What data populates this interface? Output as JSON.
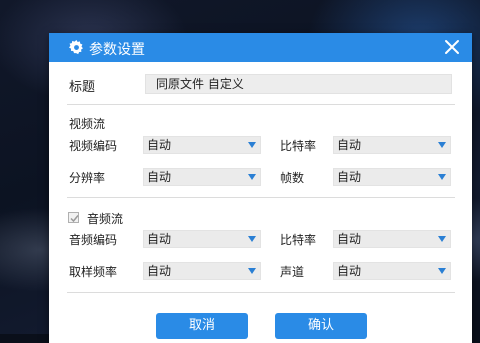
{
  "dialog": {
    "title": "参数设置",
    "name_label": "标题",
    "name_value": "同原文件 自定义"
  },
  "video": {
    "section_label": "视频流",
    "codec_label": "视频编码",
    "codec_value": "自动",
    "bitrate_label": "比特率",
    "bitrate_value": "自动",
    "resolution_label": "分辨率",
    "resolution_value": "自动",
    "framerate_label": "帧数",
    "framerate_value": "自动"
  },
  "audio": {
    "enabled": true,
    "section_label": "音频流",
    "codec_label": "音频编码",
    "codec_value": "自动",
    "bitrate_label": "比特率",
    "bitrate_value": "自动",
    "samplerate_label": "取样频率",
    "samplerate_value": "自动",
    "channel_label": "声道",
    "channel_value": "自动"
  },
  "buttons": {
    "cancel_label": "取消",
    "ok_label": "确认"
  },
  "colors": {
    "accent": "#2a8be6",
    "dropdown_arrow": "#2a7fd4"
  }
}
